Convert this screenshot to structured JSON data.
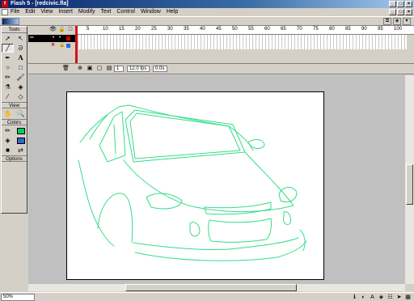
{
  "window": {
    "title": "Flash 5 - [redcivic.fla]",
    "app_icon": "f"
  },
  "menu": [
    "File",
    "Edit",
    "View",
    "Insert",
    "Modify",
    "Text",
    "Control",
    "Window",
    "Help"
  ],
  "tools": {
    "header": "Tools",
    "view_header": "View",
    "colors_header": "Colors",
    "options_header": "Options",
    "stroke_color": "#00cc66",
    "fill_color": "#3366cc"
  },
  "timeline": {
    "ruler_labels": [
      "5",
      "10",
      "15",
      "20",
      "25",
      "30",
      "35",
      "40",
      "45",
      "50",
      "55",
      "60",
      "65",
      "70",
      "75",
      "80",
      "85",
      "90",
      "95",
      "100"
    ],
    "current_frame": "1",
    "frame_rate": "12.0 fps",
    "elapsed": "0.0s"
  },
  "status": {
    "zoom": "50%"
  },
  "colors": {
    "drawing_stroke": "#33dd88",
    "stage_bg": "#c0c0c0",
    "canvas_bg": "#ffffff"
  }
}
